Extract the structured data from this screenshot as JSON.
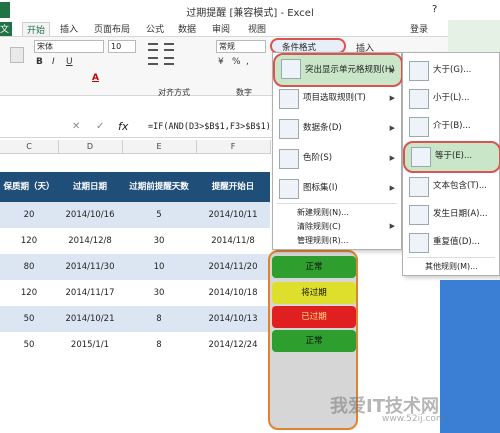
{
  "window": {
    "title": "过期提醒 [兼容模式] - Excel",
    "help": "?",
    "login": "登录"
  },
  "ribbon_tabs": [
    "文件",
    "开始",
    "插入",
    "页面布局",
    "公式",
    "数据",
    "审阅",
    "视图"
  ],
  "ribbon": {
    "font": "宋体",
    "size": "10",
    "number_format": "常规",
    "conditional_formatting": "条件格式",
    "insert": "插入",
    "group_alignment": "对齐方式",
    "group_number": "数字",
    "bold": "B",
    "italic": "I",
    "underline": "U",
    "font_color": "A",
    "currency": "¥",
    "percent": "%",
    "comma": ","
  },
  "formula": {
    "cancel": "✕",
    "enter": "✓",
    "fx": "fx",
    "text": "=IF(AND(D3>$B$1,F3>$B$1),"
  },
  "columns": [
    "C",
    "D",
    "E",
    "F"
  ],
  "table": {
    "headers": [
      "保质期（天）",
      "过期日期",
      "过期前提醒天数",
      "提醒开始日"
    ],
    "rows": [
      [
        "20",
        "2014/10/16",
        "5",
        "2014/10/11"
      ],
      [
        "120",
        "2014/12/8",
        "30",
        "2014/11/8"
      ],
      [
        "80",
        "2014/11/30",
        "10",
        "2014/11/20"
      ],
      [
        "120",
        "2014/11/17",
        "30",
        "2014/10/18"
      ],
      [
        "50",
        "2014/10/21",
        "8",
        "2014/10/13"
      ],
      [
        "50",
        "2015/1/1",
        "8",
        "2014/12/24"
      ]
    ]
  },
  "status_cells": [
    "正常",
    "将过期",
    "已过期",
    "正常"
  ],
  "cf_menu": {
    "items": [
      "突出显示单元格规则(H)",
      "项目选取规则(T)",
      "数据条(D)",
      "色阶(S)",
      "图标集(I)"
    ],
    "small_items": [
      "新建规则(N)...",
      "清除规则(C)",
      "管理规则(R)..."
    ]
  },
  "submenu": {
    "items": [
      "大于(G)...",
      "小于(L)...",
      "介于(B)...",
      "等于(E)...",
      "文本包含(T)...",
      "发生日期(A)...",
      "重复值(D)..."
    ],
    "more": "其他规则(M)..."
  },
  "watermark": "我爱IT技术网",
  "watermark_url": "www.52ij.com"
}
